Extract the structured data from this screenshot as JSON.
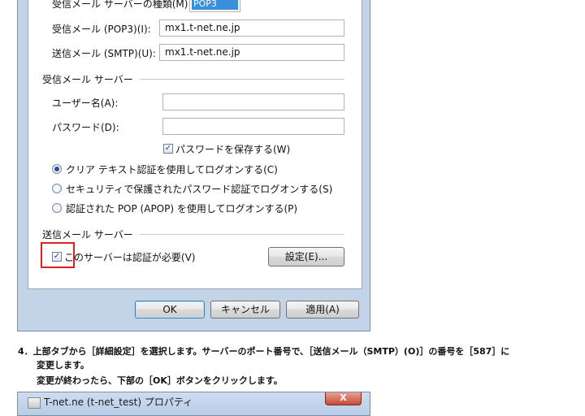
{
  "dialog": {
    "incoming_server_type_label": "受信メール サーバーの種類(M)",
    "incoming_server_type_value": "POP3",
    "incoming_pop3_label": "受信メール (POP3)(I):",
    "incoming_pop3_value": "mx1.t-net.ne.jp",
    "outgoing_smtp_label": "送信メール (SMTP)(U):",
    "outgoing_smtp_value": "mx1.t-net.ne.jp",
    "incoming_section": "受信メール サーバー",
    "username_label": "ユーザー名(A):",
    "username_value": "",
    "password_label": "パスワード(D):",
    "password_value": "",
    "save_password_label": "パスワードを保存する(W)",
    "save_password_checked": true,
    "auth_options": [
      {
        "label": "クリア テキスト認証を使用してログオンする(C)",
        "selected": true
      },
      {
        "label": "セキュリティで保護されたパスワード認証でログオンする(S)",
        "selected": false
      },
      {
        "label": "認証された POP (APOP) を使用してログオンする(P)",
        "selected": false
      }
    ],
    "outgoing_section": "送信メール サーバー",
    "smtp_auth_label": "このサーバーは認証が必要(V)",
    "smtp_auth_checked": true,
    "settings_button": "設定(E)...",
    "ok_button": "OK",
    "cancel_button": "キャンセル",
    "apply_button": "適用(A)"
  },
  "instructions": {
    "line1": "4．上部タブから［詳細設定］を選択します。サーバーのポート番号で、［送信メール（SMTP）(O)］の番号を［587］に",
    "line2": "変更します。",
    "line3": "変更が終わったら、下部の［OK］ボタンをクリックします。"
  },
  "second_window": {
    "title": "T-net.ne (t-net_test) プロパティ",
    "close_symbol": "X"
  },
  "accent_colors": {
    "highlight": "#e02020",
    "selection": "#3a8fd8",
    "window_frame": "#c3d3e8"
  }
}
